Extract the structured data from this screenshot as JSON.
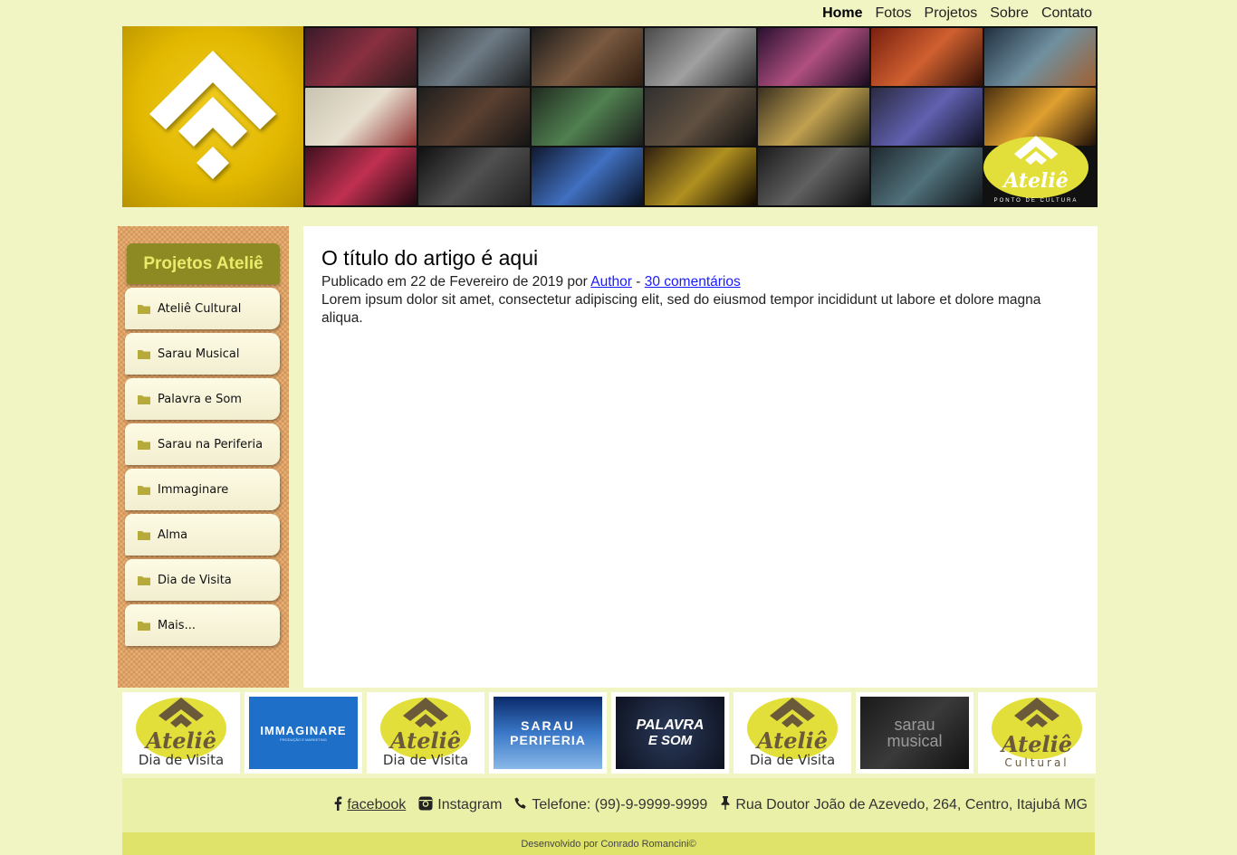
{
  "nav": {
    "items": [
      {
        "label": "Home",
        "active": true
      },
      {
        "label": "Fotos"
      },
      {
        "label": "Projetos"
      },
      {
        "label": "Sobre"
      },
      {
        "label": "Contato"
      }
    ]
  },
  "banner": {
    "logo_icon": "atelie-chevron-logo",
    "collage_logo_text": "Ateliê",
    "collage_logo_subtext": "PONTO DE CULTURA"
  },
  "sidebar": {
    "title": "Projetos Ateliê",
    "items": [
      {
        "label": "Ateliê Cultural"
      },
      {
        "label": "Sarau Musical"
      },
      {
        "label": "Palavra e Som"
      },
      {
        "label": "Sarau na Periferia"
      },
      {
        "label": "Immaginare"
      },
      {
        "label": "Alma"
      },
      {
        "label": "Dia de Visita"
      },
      {
        "label": "Mais..."
      }
    ]
  },
  "article": {
    "title": "O título do artigo é aqui",
    "published_prefix": "Publicado em 22 de Fevereiro de 2019 por",
    "author": "Author",
    "separator": "-",
    "comments": "30 comentários",
    "body": "Lorem ipsum dolor sit amet, consectetur adipiscing elit, sed do eiusmod tempor incididunt ut labore et dolore magna aliqua."
  },
  "partners": [
    {
      "title": "Ateliê",
      "subtitle": "Dia de Visita"
    },
    {
      "title": "IMMAGINARE",
      "subtitle": "PRODUÇÃO E MARKETING"
    },
    {
      "title": "Ateliê",
      "subtitle": "Dia de Visita"
    },
    {
      "title": "SARAU",
      "subtitle": "PERIFERIA"
    },
    {
      "title": "PALAVRA",
      "subtitle": "E SOM"
    },
    {
      "title": "Ateliê",
      "subtitle": "Dia de Visita"
    },
    {
      "title": "sarau",
      "subtitle": "musical"
    },
    {
      "title": "Ateliê",
      "subtitle": "Cultural"
    }
  ],
  "footer": {
    "facebook": "facebook",
    "instagram": "Instagram",
    "phone": "Telefone: (99)-9-9999-9999",
    "address": "Rua Doutor João de Azevedo, 264, Centro, Itajubá MG",
    "credits": "Desenvolvido por Conrado Romancini©"
  },
  "colors": {
    "page_bg": "#f1f4c3",
    "brand_yellow": "#e2b800",
    "sidebar_title_bg": "#8e8a23",
    "footer_bg": "#eaf0a8",
    "credits_bg": "#dfe36a",
    "link": "#1a1aff"
  }
}
